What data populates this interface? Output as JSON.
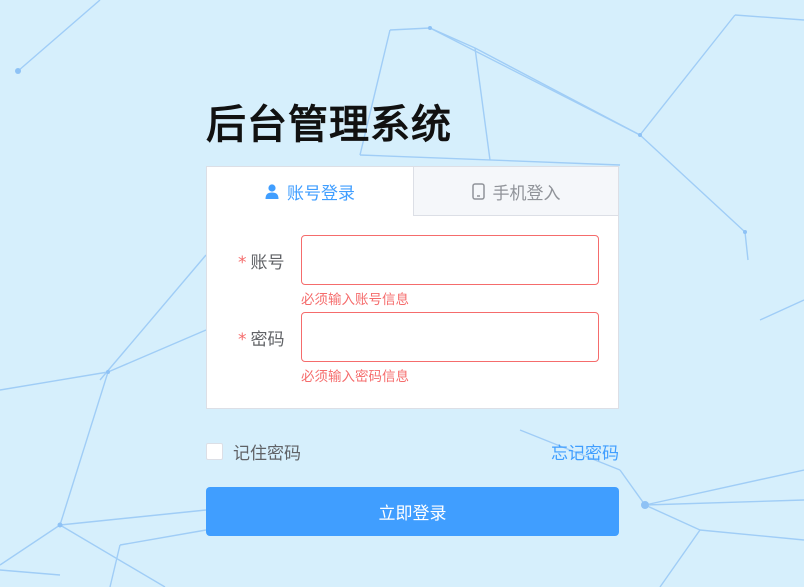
{
  "page": {
    "title": "后台管理系统"
  },
  "tabs": {
    "account": {
      "label": "账号登录",
      "icon": "user-icon",
      "active": true
    },
    "phone": {
      "label": "手机登入",
      "icon": "mobile-phone-icon",
      "active": false
    }
  },
  "form": {
    "account": {
      "required_mark": "*",
      "label": "账号",
      "value": "",
      "error": "必须输入账号信息"
    },
    "password": {
      "required_mark": "*",
      "label": "密码",
      "value": "",
      "error": "必须输入密码信息"
    }
  },
  "options": {
    "remember_label": "记住密码",
    "remember_checked": false,
    "forgot_label": "忘记密码"
  },
  "actions": {
    "login_label": "立即登录"
  },
  "colors": {
    "background": "#d6effc",
    "primary": "#409eff",
    "error": "#f56c6c",
    "network_lines": "#8ec2f5"
  }
}
